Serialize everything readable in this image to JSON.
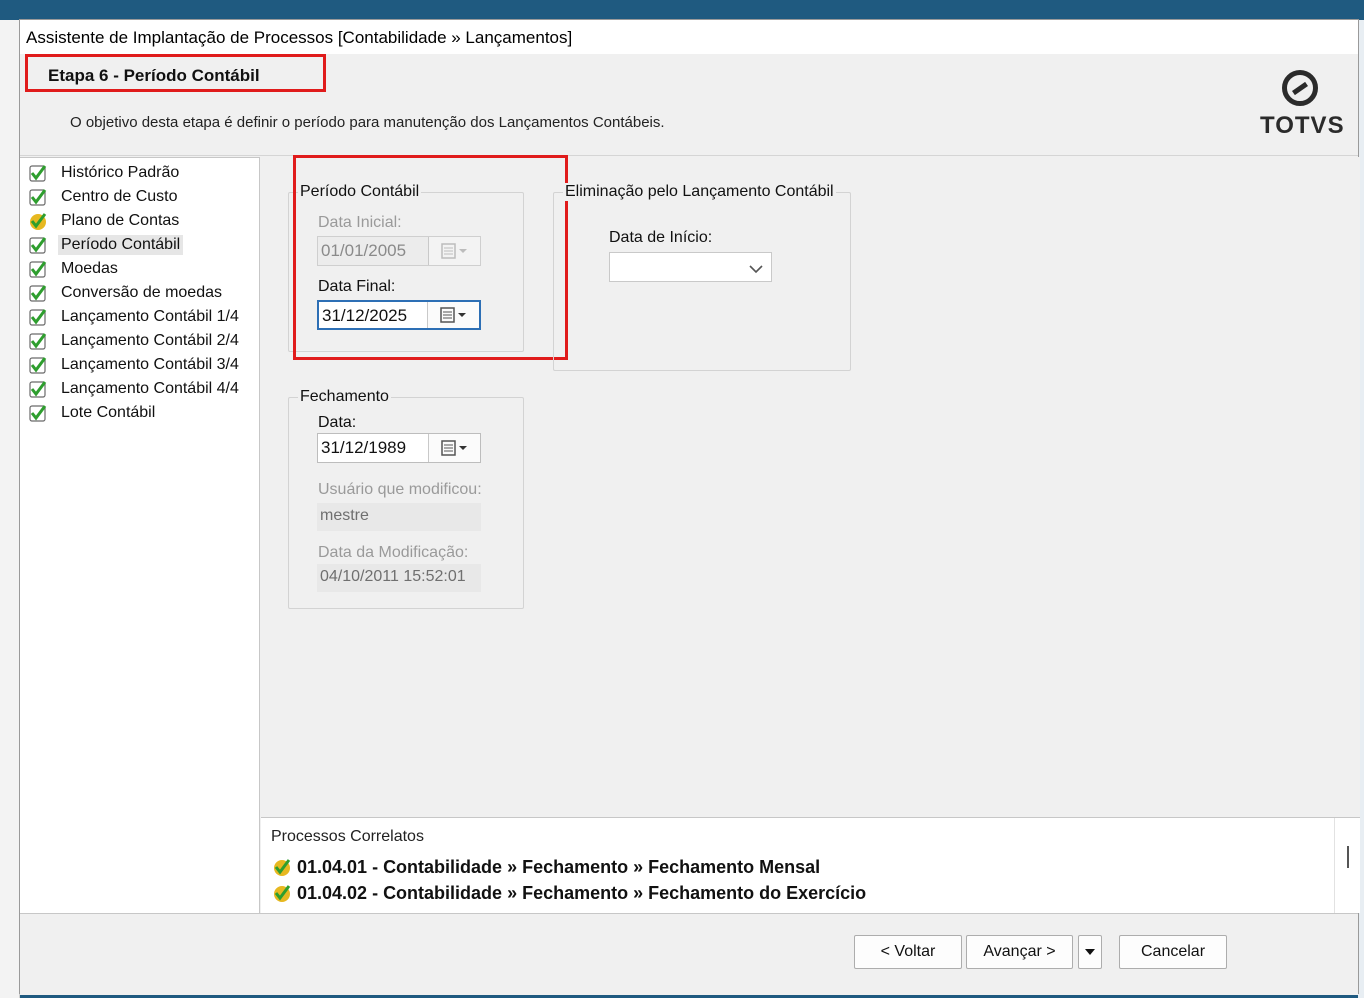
{
  "window": {
    "title": "Assistente de Implantação de Processos [Contabilidade » Lançamentos]"
  },
  "header": {
    "step_title": "Etapa 6 - Período Contábil",
    "description": "O objetivo desta etapa é definir o período para manutenção dos Lançamentos Contábeis.",
    "logo_text": "TOTVS"
  },
  "tree": {
    "items": [
      {
        "label": "Histórico Padrão",
        "icon": "green-check-icon"
      },
      {
        "label": "Centro de Custo",
        "icon": "green-check-icon"
      },
      {
        "label": "Plano de Contas",
        "icon": "yellow-check-icon"
      },
      {
        "label": "Período Contábil",
        "icon": "green-check-icon",
        "selected": true
      },
      {
        "label": "Moedas",
        "icon": "green-check-icon"
      },
      {
        "label": "Conversão de moedas",
        "icon": "green-check-icon"
      },
      {
        "label": "Lançamento Contábil 1/4",
        "icon": "green-check-icon"
      },
      {
        "label": "Lançamento Contábil 2/4",
        "icon": "green-check-icon"
      },
      {
        "label": "Lançamento Contábil 3/4",
        "icon": "green-check-icon"
      },
      {
        "label": "Lançamento Contábil 4/4",
        "icon": "green-check-icon"
      },
      {
        "label": "Lote Contábil",
        "icon": "green-check-icon"
      }
    ]
  },
  "periodo": {
    "group_title": "Período Contábil",
    "data_inicial_label": "Data Inicial:",
    "data_inicial_value": "01/01/2005",
    "data_final_label": "Data Final:",
    "data_final_value": "31/12/2025"
  },
  "eliminacao": {
    "group_title": "Eliminação pelo Lançamento Contábil",
    "data_inicio_label": "Data de Início:",
    "data_inicio_value": ""
  },
  "fechamento": {
    "group_title": "Fechamento",
    "data_label": "Data:",
    "data_value": "31/12/1989",
    "usuario_label": "Usuário que modificou:",
    "usuario_value": "mestre",
    "data_mod_label": "Data da Modificação:",
    "data_mod_value": "04/10/2011 15:52:01"
  },
  "correlatos": {
    "title": "Processos Correlatos",
    "items": [
      "01.04.01 - Contabilidade » Fechamento » Fechamento Mensal",
      "01.04.02 - Contabilidade » Fechamento » Fechamento do Exercício"
    ]
  },
  "footer": {
    "back_label": "< Voltar",
    "next_label": "Avançar >",
    "cancel_label": "Cancelar"
  },
  "colors": {
    "highlight": "#e01b1b",
    "focus_border": "#2d6fb5",
    "check_green": "#2e9e2e"
  }
}
